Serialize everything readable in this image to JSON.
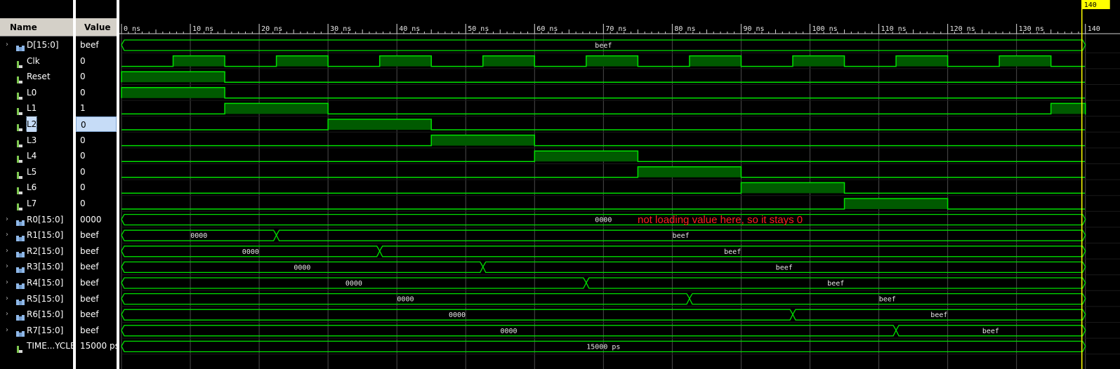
{
  "header": {
    "name_label": "Name",
    "value_label": "Value"
  },
  "cursor_label": "140",
  "time_ticks": [
    "0 ns",
    "10 ns",
    "20 ns",
    "30 ns",
    "40 ns",
    "50 ns",
    "60 ns",
    "70 ns",
    "80 ns",
    "90 ns",
    "100 ns",
    "110 ns",
    "120 ns",
    "130 ns",
    "140"
  ],
  "annotation": "not loading value here, so it stays 0",
  "signals": [
    {
      "name": "D[15:0]",
      "value": "beef",
      "kind": "bus",
      "expandable": true
    },
    {
      "name": "Clk",
      "value": "0",
      "kind": "bit"
    },
    {
      "name": "Reset",
      "value": "0",
      "kind": "bit"
    },
    {
      "name": "L0",
      "value": "0",
      "kind": "bit"
    },
    {
      "name": "L1",
      "value": "1",
      "kind": "bit"
    },
    {
      "name": "L2",
      "value": "0",
      "kind": "bit",
      "selected": true
    },
    {
      "name": "L3",
      "value": "0",
      "kind": "bit"
    },
    {
      "name": "L4",
      "value": "0",
      "kind": "bit"
    },
    {
      "name": "L5",
      "value": "0",
      "kind": "bit"
    },
    {
      "name": "L6",
      "value": "0",
      "kind": "bit"
    },
    {
      "name": "L7",
      "value": "0",
      "kind": "bit"
    },
    {
      "name": "R0[15:0]",
      "value": "0000",
      "kind": "bus",
      "expandable": true
    },
    {
      "name": "R1[15:0]",
      "value": "beef",
      "kind": "bus",
      "expandable": true
    },
    {
      "name": "R2[15:0]",
      "value": "beef",
      "kind": "bus",
      "expandable": true
    },
    {
      "name": "R3[15:0]",
      "value": "beef",
      "kind": "bus",
      "expandable": true
    },
    {
      "name": "R4[15:0]",
      "value": "beef",
      "kind": "bus",
      "expandable": true
    },
    {
      "name": "R5[15:0]",
      "value": "beef",
      "kind": "bus",
      "expandable": true
    },
    {
      "name": "R6[15:0]",
      "value": "beef",
      "kind": "bus",
      "expandable": true
    },
    {
      "name": "R7[15:0]",
      "value": "beef",
      "kind": "bus",
      "expandable": true
    },
    {
      "name": "TIME...YCLE",
      "value": "15000 ps",
      "kind": "bus-const"
    }
  ],
  "waves": {
    "D": {
      "segments": [
        {
          "from": 0,
          "to": 140,
          "label": "beef"
        }
      ]
    },
    "Clk": {
      "high": [
        [
          7.5,
          15
        ],
        [
          22.5,
          30
        ],
        [
          37.5,
          45
        ],
        [
          52.5,
          60
        ],
        [
          67.5,
          75
        ],
        [
          82.5,
          90
        ],
        [
          97.5,
          105
        ],
        [
          112.5,
          120
        ],
        [
          127.5,
          135
        ]
      ]
    },
    "Reset": {
      "high": [
        [
          0,
          15
        ]
      ]
    },
    "L0": {
      "high": [
        [
          0,
          15
        ]
      ]
    },
    "L1": {
      "high": [
        [
          15,
          30
        ],
        [
          135,
          140
        ]
      ]
    },
    "L2": {
      "high": [
        [
          30,
          45
        ]
      ]
    },
    "L3": {
      "high": [
        [
          45,
          60
        ]
      ]
    },
    "L4": {
      "high": [
        [
          60,
          75
        ]
      ]
    },
    "L5": {
      "high": [
        [
          75,
          90
        ]
      ]
    },
    "L6": {
      "high": [
        [
          90,
          105
        ]
      ]
    },
    "L7": {
      "high": [
        [
          105,
          120
        ]
      ]
    },
    "R0": {
      "segments": [
        {
          "from": 0,
          "to": 140,
          "label": "0000"
        }
      ]
    },
    "R1": {
      "segments": [
        {
          "from": 0,
          "to": 22.5,
          "label": "0000"
        },
        {
          "from": 22.5,
          "to": 140,
          "label": "beef"
        }
      ]
    },
    "R2": {
      "segments": [
        {
          "from": 0,
          "to": 37.5,
          "label": "0000"
        },
        {
          "from": 37.5,
          "to": 140,
          "label": "beef"
        }
      ]
    },
    "R3": {
      "segments": [
        {
          "from": 0,
          "to": 52.5,
          "label": "0000"
        },
        {
          "from": 52.5,
          "to": 140,
          "label": "beef"
        }
      ]
    },
    "R4": {
      "segments": [
        {
          "from": 0,
          "to": 67.5,
          "label": "0000"
        },
        {
          "from": 67.5,
          "to": 140,
          "label": "beef"
        }
      ]
    },
    "R5": {
      "segments": [
        {
          "from": 0,
          "to": 82.5,
          "label": "0000"
        },
        {
          "from": 82.5,
          "to": 140,
          "label": "beef"
        }
      ]
    },
    "R6": {
      "segments": [
        {
          "from": 0,
          "to": 97.5,
          "label": "0000"
        },
        {
          "from": 97.5,
          "to": 140,
          "label": "beef"
        }
      ]
    },
    "R7": {
      "segments": [
        {
          "from": 0,
          "to": 112.5,
          "label": "0000"
        },
        {
          "from": 112.5,
          "to": 140,
          "label": "beef"
        }
      ]
    },
    "TIME": {
      "segments": [
        {
          "from": 0,
          "to": 140,
          "label": "15000 ps"
        }
      ]
    }
  },
  "colors": {
    "wave": "#00e000",
    "fill": "#005a00",
    "grid": "#4a4a4a",
    "cursor": "#ffff00",
    "annotation": "#ff2020",
    "header_bg": "#d4d0c8"
  }
}
